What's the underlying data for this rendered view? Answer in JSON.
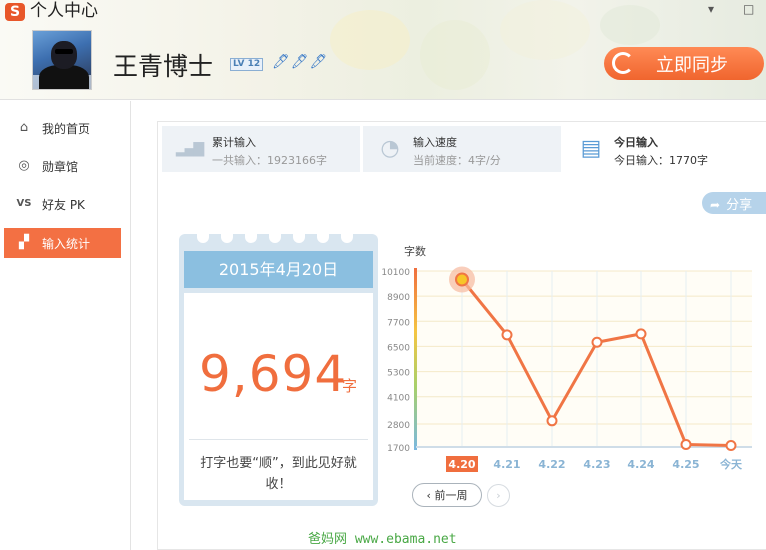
{
  "window": {
    "title": "个人中心",
    "logo": "S",
    "minimize_glyph": "▾",
    "restore_glyph": "□"
  },
  "profile": {
    "username": "王青博士",
    "level": "LV 12",
    "badge_glyphs": "🖊🖊🖊",
    "sync_label": "立即同步"
  },
  "sidebar": {
    "items": [
      {
        "label": "我的首页",
        "icon": "home-icon",
        "glyph": "⌂",
        "active": false
      },
      {
        "label": "勋章馆",
        "icon": "medal-icon",
        "glyph": "◎",
        "active": false
      },
      {
        "label": "好友 PK",
        "icon": "vs-icon",
        "glyph": "VS",
        "active": false
      },
      {
        "label": "输入统计",
        "icon": "chart-icon",
        "glyph": "▞",
        "active": true
      }
    ]
  },
  "stats": [
    {
      "title": "累计输入",
      "value": "一共输入：1923166字",
      "icon": "bar-chart-icon",
      "glyph": "▂▄▇",
      "active": false
    },
    {
      "title": "输入速度",
      "value": "当前速度：4字/分",
      "icon": "speedometer-icon",
      "glyph": "◔",
      "active": false
    },
    {
      "title": "今日输入",
      "value": "今日输入：1770字",
      "icon": "calendar-icon",
      "glyph": "▤",
      "active": true
    }
  ],
  "share_label": "分享",
  "share_glyph": "➦",
  "day_card": {
    "date": "2015年4月20日",
    "count": "9,694",
    "unit": "字",
    "message": "打字也要“顺”，到此见好就收！"
  },
  "chart_data": {
    "type": "line",
    "ylabel": "字数",
    "categories": [
      "4.20",
      "4.21",
      "4.22",
      "4.23",
      "4.24",
      "4.25",
      "今天"
    ],
    "values": [
      9694,
      7050,
      2950,
      6700,
      7100,
      1820,
      1770
    ],
    "yticks": [
      1700,
      2800,
      4100,
      5300,
      6500,
      7700,
      8900,
      10100
    ],
    "ylim": [
      1700,
      10100
    ],
    "highlight_index": 0,
    "line_color": "#f07545",
    "grid": true
  },
  "nav": {
    "prev_week": "前一周",
    "prev_glyph": "‹",
    "next_glyph": "›"
  },
  "watermark": "爸妈网 www.ebama.net"
}
